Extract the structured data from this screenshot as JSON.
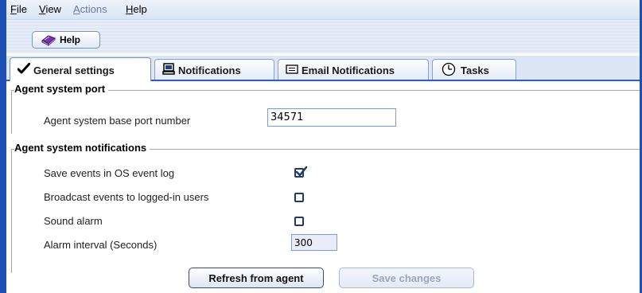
{
  "menubar": {
    "items": [
      {
        "label": "File",
        "underline": "F",
        "rest": "ile",
        "disabled": false
      },
      {
        "label": "View",
        "underline": "V",
        "rest": "iew",
        "disabled": false
      },
      {
        "label": "Actions",
        "underline": "A",
        "rest": "ctions",
        "disabled": true
      },
      {
        "label": "Help",
        "underline": "H",
        "rest": "elp",
        "disabled": false
      }
    ]
  },
  "toolbar": {
    "help_label": "Help",
    "help_icon": "book-icon"
  },
  "tabs": [
    {
      "label": "General settings",
      "icon": "checkmark-icon",
      "active": true
    },
    {
      "label": "Notifications",
      "icon": "computer-icon",
      "active": false
    },
    {
      "label": "Email Notifications",
      "icon": "envelope-icon",
      "active": false
    },
    {
      "label": "Tasks",
      "icon": "clock-icon",
      "active": false
    }
  ],
  "port_group": {
    "title": "Agent system port",
    "base_port_label": "Agent system base port number",
    "base_port_value": "34571"
  },
  "notifications_group": {
    "title": "Agent system notifications",
    "save_events_label": "Save events in OS event log",
    "save_events_checked": true,
    "broadcast_label": "Broadcast events to logged-in users",
    "broadcast_checked": false,
    "sound_alarm_label": "Sound alarm",
    "sound_alarm_checked": false,
    "alarm_interval_label": "Alarm interval (Seconds)",
    "alarm_interval_value": "300"
  },
  "actions": {
    "refresh_label": "Refresh from agent",
    "save_label": "Save changes",
    "save_disabled": true
  },
  "colors": {
    "window_border": "#1e4fb4",
    "tab_accent": "#2a5fc2"
  }
}
